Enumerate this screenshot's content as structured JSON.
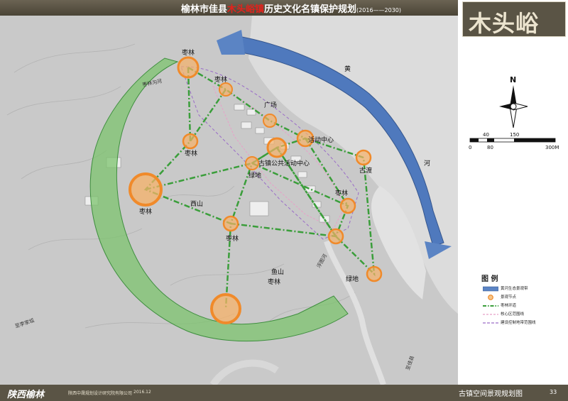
{
  "header": {
    "title_prefix": "榆林市佳县",
    "title_highlight": "木头峪镇",
    "title_suffix": "历史文化名镇保护规划",
    "years": "(2016——2030)"
  },
  "brand": {
    "logo_text": "木头峪"
  },
  "map": {
    "river_labels": [
      "黄",
      "河"
    ],
    "place_labels": [
      "枣林",
      "枣林",
      "枣林",
      "枣林",
      "枣林",
      "枣林",
      "枣林",
      "广场",
      "活动中心",
      "古镇公共活动中心",
      "绿地",
      "绿地",
      "古渡",
      "西山",
      "鱼山",
      "枣林沟河",
      "浮图河",
      "至李家坬",
      "至佳县"
    ]
  },
  "compass": {
    "north": "N"
  },
  "scale": {
    "top_ticks": [
      "40",
      "150"
    ],
    "bottom_ticks": [
      "0",
      "80",
      "300M"
    ]
  },
  "legend": {
    "title": "图 例",
    "items": [
      {
        "label": "黄河生态景观带",
        "color": "#5b84c4"
      },
      {
        "label": "景观节点",
        "color": "#f0a050"
      },
      {
        "label": "枣林环道",
        "color": "#3a9e3a"
      },
      {
        "label": "核心区范围线",
        "color": "#e8a0c8"
      },
      {
        "label": "建设控制地带范围线",
        "color": "#9a6cc8"
      }
    ]
  },
  "footer": {
    "logo": "陕西榆林",
    "org": "陕西中晟规划设计研究院有限公司",
    "date": "2016.12",
    "map_name": "古镇空间景观规划图",
    "page": "33"
  }
}
